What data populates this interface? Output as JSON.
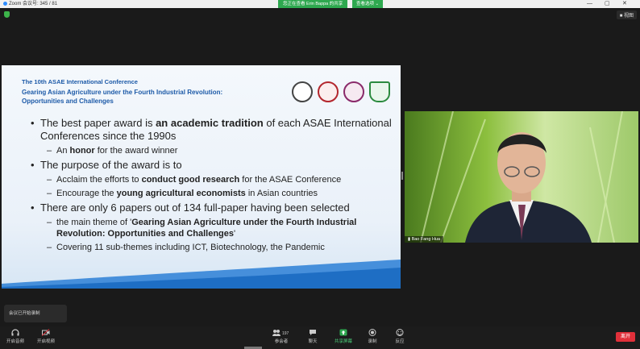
{
  "window": {
    "app_title": "Zoom",
    "app_title_rest": "会议号: 345 / 81",
    "share_banner": "您正在查看 Erin Bappa 的共享",
    "share_options": "查看选项 ⌄"
  },
  "view_button": "■ 视图",
  "slide": {
    "conference": "The 10th ASAE International Conference",
    "theme": "Gearing Asian Agriculture under the Fourth Industrial Revolution: Opportunities and Challenges",
    "bullets": [
      {
        "pre": "The best paper award is ",
        "strong": "an academic tradition",
        "post": " of each ASAE International Conferences since the 1990s",
        "subs": [
          {
            "pre": "An ",
            "strong": "honor",
            "post": " for the award winner"
          }
        ]
      },
      {
        "pre": "The purpose of the award is to",
        "strong": "",
        "post": "",
        "subs": [
          {
            "pre": "Acclaim the efforts to ",
            "strong": "conduct good research",
            "post": " for the ASAE Conference"
          },
          {
            "pre": "Encourage the ",
            "strong": "young agricultural economists",
            "post": " in Asian countries"
          }
        ]
      },
      {
        "pre": "There are only 6 papers out of 134 full-paper having been selected",
        "strong": "",
        "post": "",
        "subs": [
          {
            "pre": "the main theme of '",
            "strong": "Gearing Asian Agriculture under the Fourth Industrial Revolution: Opportunities and Challenges",
            "post": "'"
          },
          {
            "pre": " Covering 11 sub-themes including ICT, Biotechnology, the Pandemic",
            "strong": "",
            "post": ""
          }
        ]
      }
    ],
    "logos": [
      "ASAE",
      "PKU",
      "Tsinghua",
      "CAU"
    ]
  },
  "participant_name": "Bao Fang Hua",
  "caption_text": "会议已开始录制",
  "toolbar": {
    "left": [
      {
        "label": "开启音频",
        "icon": "headphone-icon"
      },
      {
        "label": "开启视频",
        "icon": "video-off-icon"
      }
    ],
    "center": [
      {
        "label": "参会者",
        "icon": "participants-icon",
        "count": "197"
      },
      {
        "label": "聊天",
        "icon": "chat-icon"
      },
      {
        "label": "共享屏幕",
        "icon": "share-screen-icon"
      },
      {
        "label": "录制",
        "icon": "record-icon"
      },
      {
        "label": "反应",
        "icon": "reaction-icon"
      }
    ],
    "end_label": "离开"
  },
  "colors": {
    "accent": "#1d5aa8",
    "share_green": "#2ea84f",
    "end_red": "#e0303a"
  }
}
